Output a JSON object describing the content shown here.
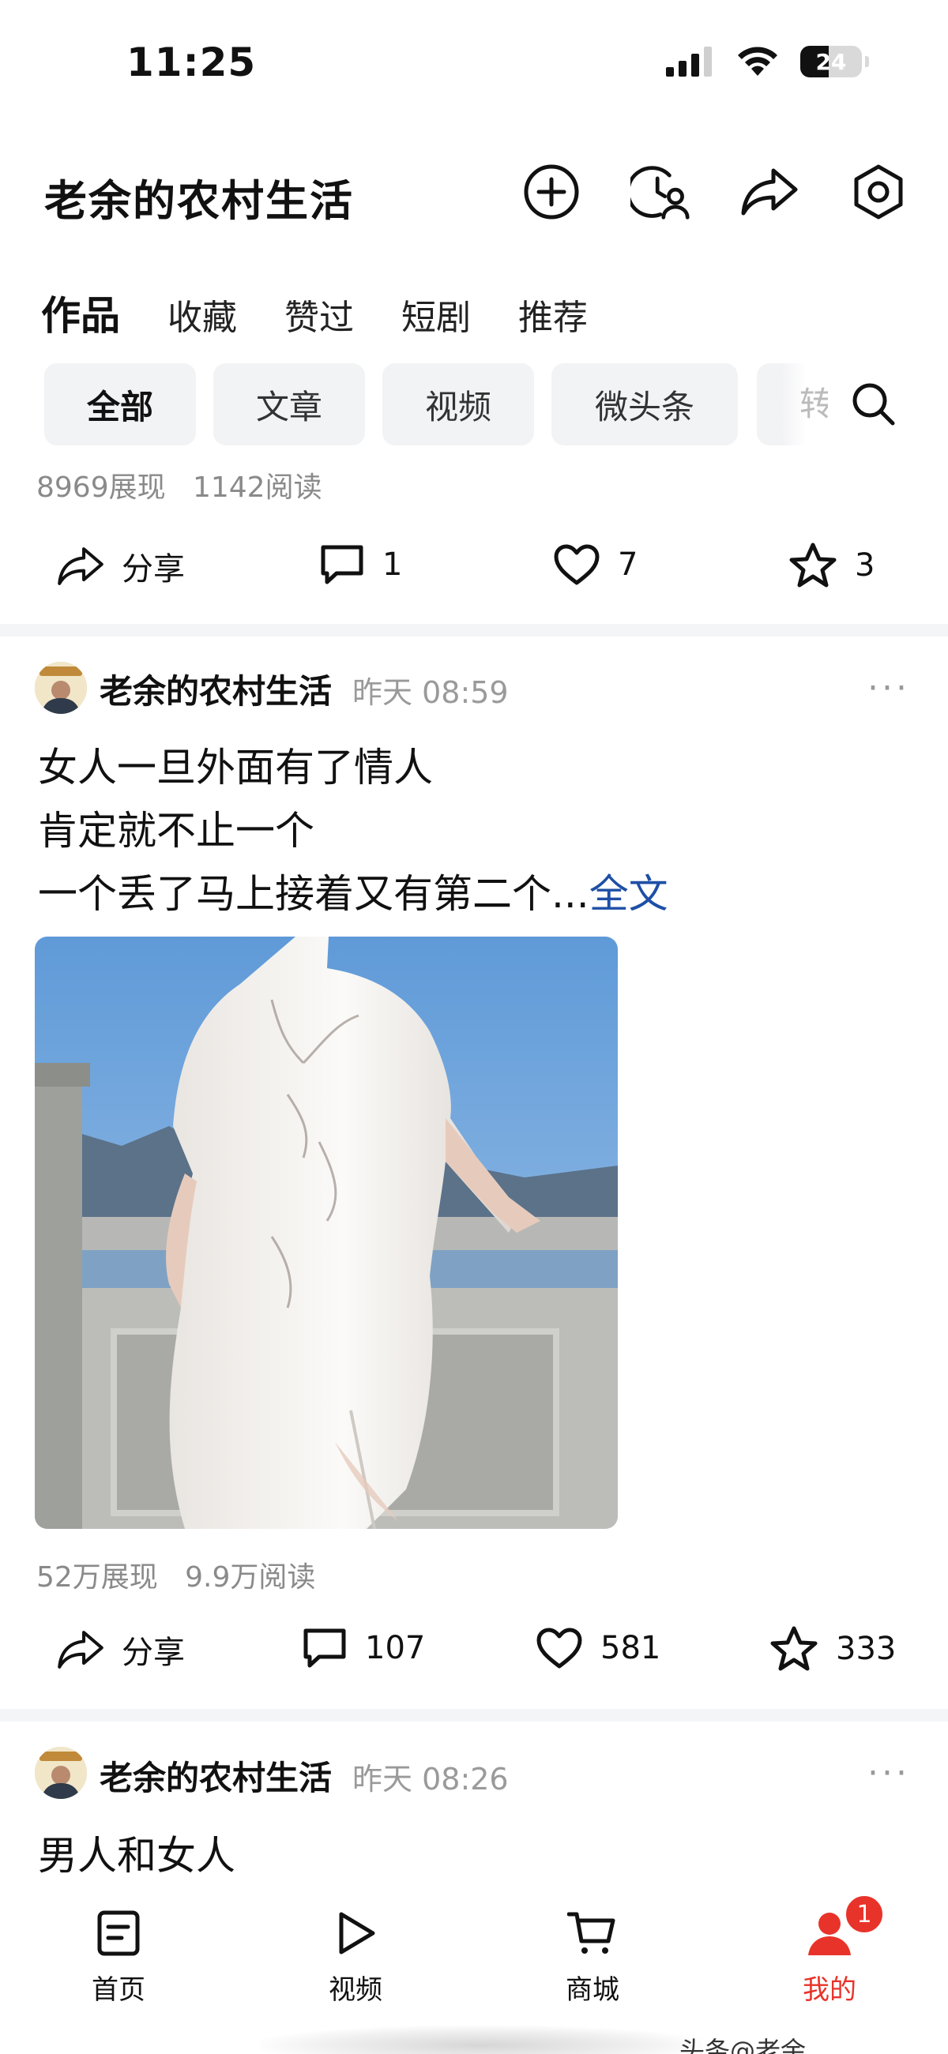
{
  "status_bar": {
    "time": "11:25",
    "battery": "24"
  },
  "header": {
    "title": "老余的农村生活"
  },
  "tabs": [
    {
      "label": "作品"
    },
    {
      "label": "收藏"
    },
    {
      "label": "赞过"
    },
    {
      "label": "短剧"
    },
    {
      "label": "推荐"
    }
  ],
  "filters": [
    {
      "label": "全部"
    },
    {
      "label": "文章"
    },
    {
      "label": "视频"
    },
    {
      "label": "微头条"
    },
    {
      "label": "转"
    }
  ],
  "prev_post": {
    "stats": {
      "impressions": "8969展现",
      "reads": "1142阅读"
    },
    "actions": {
      "share": "分享",
      "comments": "1",
      "likes": "7",
      "favorites": "3"
    }
  },
  "post1": {
    "author": "老余的农村生活",
    "time": "昨天 08:59",
    "lines": [
      "女人一旦外面有了情人",
      "肯定就不止一个",
      "一个丢了马上接着又有第二个..."
    ],
    "read_more": "全文",
    "stats": {
      "impressions": "52万展现",
      "reads": "9.9万阅读"
    },
    "actions": {
      "share": "分享",
      "comments": "107",
      "likes": "581",
      "favorites": "333"
    }
  },
  "post2": {
    "author": "老余的农村生活",
    "time": "昨天 08:26",
    "lines": [
      "男人和女人"
    ]
  },
  "bottom_nav": [
    {
      "label": "首页",
      "icon": "home-icon"
    },
    {
      "label": "视频",
      "icon": "play-icon"
    },
    {
      "label": "商城",
      "icon": "cart-icon"
    },
    {
      "label": "我的",
      "icon": "person-icon"
    }
  ],
  "badge": "1",
  "watermark": "头条@老余",
  "colors": {
    "accent_red": "#e8332a",
    "link_blue": "#1e4fa6"
  }
}
